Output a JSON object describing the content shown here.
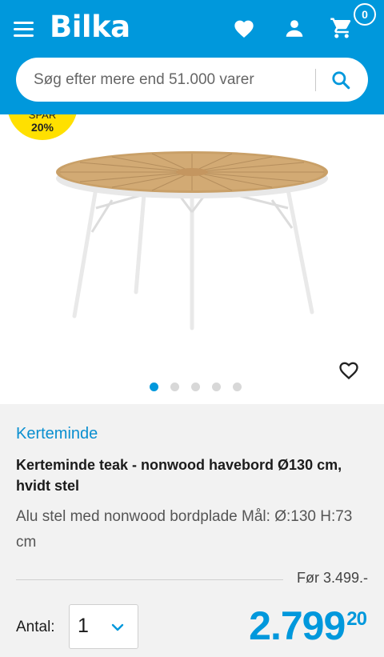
{
  "header": {
    "logo": "Bilka",
    "cart_count": "0"
  },
  "search": {
    "placeholder": "Søg efter mere end 51.000 varer"
  },
  "gallery": {
    "badge_line1": "SPAR",
    "badge_line2": "20%",
    "badge_color": "#ffe000",
    "slide_count": 5,
    "active_slide": 1
  },
  "product": {
    "brand": "Kerteminde",
    "title": "Kerteminde teak - nonwood havebord Ø130 cm, hvidt stel",
    "description": "Alu stel med nonwood bordplade Mål: Ø:130 H:73 cm",
    "before_price": "Før 3.499.-",
    "quantity_label": "Antal:",
    "quantity_value": "1",
    "price_main": "2.799",
    "price_cents": "20"
  },
  "colors": {
    "brand_blue": "#0098dc",
    "badge_yellow": "#ffe000"
  },
  "icons": [
    "menu-icon",
    "heart-icon",
    "user-icon",
    "cart-icon",
    "search-icon",
    "chevron-down-icon"
  ]
}
